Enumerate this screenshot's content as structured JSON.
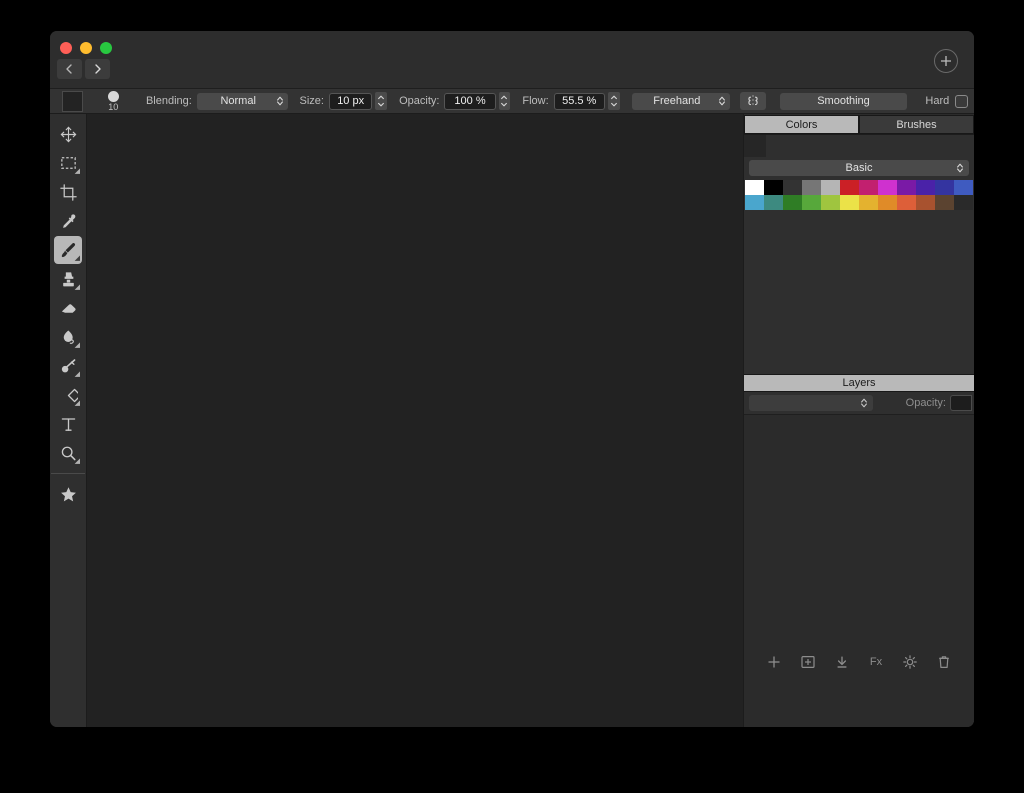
{
  "window": {
    "traffic_lights": [
      "close",
      "minimize",
      "maximize"
    ],
    "nav": {
      "back_label": "Back",
      "forward_label": "Forward"
    },
    "add_document_label": "New Document"
  },
  "options_bar": {
    "foreground_swatch_color": "#232323",
    "brush_preview_size": "10",
    "blending_label": "Blending:",
    "blending_value": "Normal",
    "size_label": "Size:",
    "size_value": "10 px",
    "opacity_label": "Opacity:",
    "opacity_value": "100 %",
    "flow_label": "Flow:",
    "flow_value": "55.5 %",
    "stroke_mode_value": "Freehand",
    "stroke_style_icon": "dashed-stroke-icon",
    "smoothing_label": "Smoothing",
    "hard_label": "Hard",
    "hard_checked": false
  },
  "tools": [
    {
      "name": "move",
      "label": "Move",
      "selected": false,
      "has_submenu": false
    },
    {
      "name": "rectangular-select",
      "label": "Rectangular Selection",
      "selected": false,
      "has_submenu": true
    },
    {
      "name": "crop",
      "label": "Crop",
      "selected": false,
      "has_submenu": false
    },
    {
      "name": "eyedropper",
      "label": "Color Picker",
      "selected": false,
      "has_submenu": false
    },
    {
      "name": "paintbrush",
      "label": "Paintbrush",
      "selected": true,
      "has_submenu": true
    },
    {
      "name": "clone-stamp",
      "label": "Clone Stamp",
      "selected": false,
      "has_submenu": true
    },
    {
      "name": "eraser",
      "label": "Eraser",
      "selected": false,
      "has_submenu": false
    },
    {
      "name": "smudge",
      "label": "Smudge",
      "selected": false,
      "has_submenu": true
    },
    {
      "name": "blur",
      "label": "Blur",
      "selected": false,
      "has_submenu": true
    },
    {
      "name": "shape",
      "label": "Shape",
      "selected": false,
      "has_submenu": true
    },
    {
      "name": "text",
      "label": "Text",
      "selected": false,
      "has_submenu": false
    },
    {
      "name": "zoom",
      "label": "Zoom",
      "selected": false,
      "has_submenu": true
    },
    {
      "name": "effects",
      "label": "Effects",
      "selected": false,
      "has_submenu": false
    }
  ],
  "canvas": {
    "background_color": "#222222"
  },
  "right_dock": {
    "tabs": [
      {
        "label": "Colors",
        "active": true
      },
      {
        "label": "Brushes",
        "active": false
      }
    ],
    "colors_panel": {
      "current_color": "#262626",
      "palette_name": "Basic",
      "swatches": [
        "#ffffff",
        "#000000",
        "#333333",
        "#767676",
        "#b5b5b5",
        "#cb2026",
        "#c2206f",
        "#cf31cf",
        "#7a1aa6",
        "#4a22a8",
        "#3434a0",
        "#3f5bc0",
        "#4aa6cd",
        "#3d8a80",
        "#2f7d25",
        "#57a83b",
        "#9fc53f",
        "#ebe248",
        "#e4b22f",
        "#e08b28",
        "#dd5f39",
        "#a8522f",
        "#5b4330",
        "#2a2a2a"
      ]
    },
    "layers_panel": {
      "title": "Layers",
      "blend_mode_value": "",
      "opacity_label": "Opacity:",
      "opacity_value": "",
      "toolbar": [
        {
          "name": "add-layer-icon",
          "label": "Add Layer",
          "glyph": "+"
        },
        {
          "name": "add-mask-icon",
          "label": "Add Mask",
          "glyph": "boxed-plus"
        },
        {
          "name": "merge-down-icon",
          "label": "Merge Down",
          "glyph": "download-arrow"
        },
        {
          "name": "effects-fx-icon",
          "label": "Layer Effects",
          "glyph": "Fx"
        },
        {
          "name": "adjustment-icon",
          "label": "Adjustments",
          "glyph": "sun"
        },
        {
          "name": "delete-layer-icon",
          "label": "Delete Layer",
          "glyph": "trash"
        }
      ]
    }
  }
}
